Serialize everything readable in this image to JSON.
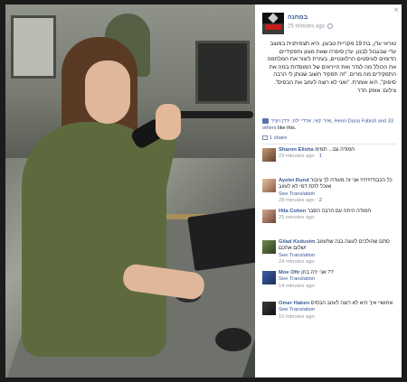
{
  "close_label": "×",
  "post": {
    "page_name": "במחנה",
    "time": "25 minutes ago",
    "caption": "טוראי עדן, בת 19 מקריית טבעון, היא תצפיתנית במוצב עדי שבגבול לבנון. עדן סיפרה שאת מגוון ותפקידיים הדומים לוגיסטים הרלוונטיים, בעזרת ליצור את המלחמה את הכולל מה לגדר ואת הייראים של המוסדות במה את התפקידים מה מרים. \"זה תפקיד חשוב שנותן לי הרבה סיפוק\", היא אומרת. \"ואני לא רוצה לעזוב את הבסיס\". צילום: אופק הדר",
    "likes_names": "ואיר ינאי, ארדי ילוז, ירדן ויציר, Henri Dana Fabish",
    "likes_others": "and 33 others",
    "likes_tail": "like this.",
    "share_label": "1 share"
  },
  "comments": [
    {
      "name": "Sharon Elisha",
      "text": "חמודה גם... תמימ",
      "meta_time": "29 minutes ago",
      "likes": "1",
      "translate": ""
    },
    {
      "name": "Ayelet Rund",
      "text": "כל הכבוד!!!!!!!! אני זה מעודה לך ציבור ואוכל לתת דמי לא לעזוב",
      "meta_time": "28 minutes ago",
      "likes": "2",
      "translate": "See Translation"
    },
    {
      "name": "Hila Cohen",
      "text": "חמודה היתה עם הרבה הסבר",
      "meta_time": "25 minutes ago",
      "likes": "",
      "translate": ""
    },
    {
      "name": "Gilad Keduvim",
      "text": "סתם שהולכים לעוגה בנה שתעזוב שלום אתכם!",
      "meta_time": "24 minutes ago",
      "likes": "",
      "translate": "See Translation"
    },
    {
      "name": "Moe Ofir",
      "text": "אני ירה בחן ??",
      "meta_time": "14 minutes ago",
      "likes": "",
      "translate": "See Translation"
    },
    {
      "name": "Omer Haken",
      "text": "אחושיי איך היא לא רוצה לעזוב הבסיס",
      "meta_time": "10 minutes ago",
      "likes": "",
      "translate": "See Translation"
    }
  ]
}
